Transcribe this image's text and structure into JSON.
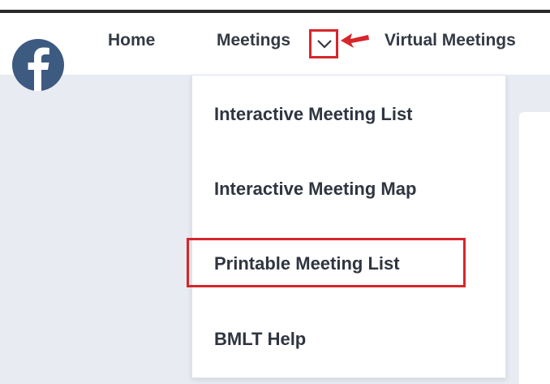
{
  "nav": {
    "items": [
      {
        "label": "Home"
      },
      {
        "label": "Meetings"
      },
      {
        "label": "Virtual Meetings"
      }
    ]
  },
  "dropdown": {
    "items": [
      {
        "label": "Interactive Meeting List"
      },
      {
        "label": "Interactive Meeting Map"
      },
      {
        "label": "Printable Meeting List",
        "highlighted": true
      },
      {
        "label": "BMLT Help"
      }
    ]
  },
  "icons": {
    "social": "facebook-icon",
    "toggle": "chevron-down-icon",
    "pointer": "arrow-left-icon"
  },
  "colors": {
    "annotation": "#d7262b",
    "nav_text": "#333a45",
    "facebook": "#3d5a80",
    "background": "#e8ecf2"
  }
}
